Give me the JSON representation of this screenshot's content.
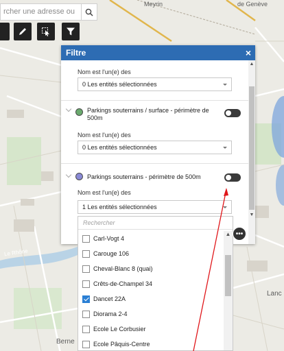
{
  "search": {
    "placeholder": "rcher une adresse ou"
  },
  "map": {
    "labels": {
      "meyrin": "Meyrin",
      "de_geneve": "de Genève",
      "rhone": "Le Rhône",
      "lancy": "Lanc",
      "berne": "Berne"
    }
  },
  "toolbar": {
    "icons": [
      "pencil-icon",
      "select-icon",
      "filter-icon"
    ]
  },
  "panel": {
    "title": "Filtre",
    "close": "×",
    "group0": {
      "filter_label": "Nom est l'un(e) des",
      "selected": "0 Les entités sélectionnées"
    },
    "group1": {
      "title": "Parkings souterrains / surface - périmètre de 500m",
      "color": "#6aaa6e",
      "filter_label": "Nom est l'un(e) des",
      "selected": "0 Les entités sélectionnées"
    },
    "group2": {
      "title": "Parkings souterrains - périmètre de 500m",
      "color": "#8a8ad6",
      "filter_label": "Nom est l'un(e) des",
      "selected": "1 Les entités sélectionnées"
    }
  },
  "dropdown": {
    "search_placeholder": "Rechercher",
    "items": [
      {
        "label": "Carl-Vogt 4",
        "checked": false
      },
      {
        "label": "Carouge 106",
        "checked": false
      },
      {
        "label": "Cheval-Blanc 8 (quai)",
        "checked": false
      },
      {
        "label": "Crêts-de-Champel 34",
        "checked": false
      },
      {
        "label": "Dancet 22A",
        "checked": true
      },
      {
        "label": "Diorama 2-4",
        "checked": false
      },
      {
        "label": "Ecole Le Corbusier",
        "checked": false
      },
      {
        "label": "Ecole Pâquis-Centre",
        "checked": false
      }
    ]
  },
  "colors": {
    "accent": "#2d6cb3",
    "arrow": "#e0161a"
  }
}
